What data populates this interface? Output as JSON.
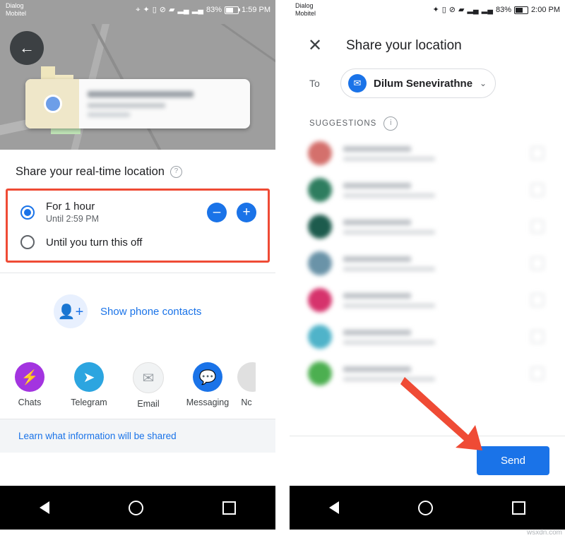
{
  "left": {
    "status": {
      "carrier_line1": "Dialog",
      "carrier_line2": "Mobitel",
      "icons": [
        "location-icon",
        "bluetooth-icon",
        "vibrate-icon",
        "alarm-off-icon",
        "wifi-icon",
        "signal-icon",
        "signal-icon"
      ],
      "battery_percent": "83%",
      "time": "1:59 PM"
    },
    "map": {
      "back_icon": "back-arrow-icon",
      "card_title_blurred": "",
      "card_sub_blurred": ""
    },
    "sheet": {
      "title": "Share your real-time location",
      "help_icon": "help-icon",
      "option1": {
        "label": "For 1 hour",
        "sub": "Until 2:59 PM",
        "selected": true,
        "minus": "–",
        "plus": "+"
      },
      "option2": {
        "label": "Until you turn this off",
        "selected": false
      },
      "contacts": {
        "icon": "person-add-icon",
        "label": "Show phone contacts"
      },
      "apps": [
        {
          "name": "Chats",
          "icon": "messenger-icon",
          "color": "#a334e0",
          "glyph": "⚡"
        },
        {
          "name": "Telegram",
          "icon": "telegram-icon",
          "color": "#2ca5e0",
          "glyph": "➤"
        },
        {
          "name": "Email",
          "icon": "email-icon",
          "color": "#f1f3f4",
          "glyph": "✉"
        },
        {
          "name": "Messaging",
          "icon": "messaging-icon",
          "color": "#1a73e8",
          "glyph": "💬"
        },
        {
          "name": "Nc",
          "icon": "more-apps-icon",
          "color": "#e0e0e0",
          "glyph": ""
        }
      ],
      "learn_more": "Learn what information will be shared"
    },
    "nav": {
      "back": "nav-back-icon",
      "home": "nav-home-icon",
      "recents": "nav-recents-icon"
    }
  },
  "right": {
    "status": {
      "carrier_line1": "Dialog",
      "carrier_line2": "Mobitel",
      "icons": [
        "bluetooth-icon",
        "vibrate-icon",
        "alarm-off-icon",
        "wifi-icon",
        "signal-icon",
        "signal-icon"
      ],
      "battery_percent": "83%",
      "time": "2:00 PM"
    },
    "header": {
      "close_icon": "close-icon",
      "title": "Share your location"
    },
    "to_field": {
      "label": "To",
      "avatar_icon": "mail-avatar-icon",
      "recipient": "Dilum Senevirathne",
      "chevron": "⌄"
    },
    "suggestions": {
      "label": "SUGGESTIONS",
      "info_icon": "info-icon",
      "rows": [
        {
          "avatar_color": "#d4706c"
        },
        {
          "avatar_color": "#2e7d5f"
        },
        {
          "avatar_color": "#1d5b4d"
        },
        {
          "avatar_color": "#6a93a8"
        },
        {
          "avatar_color": "#d6336c"
        },
        {
          "avatar_color": "#4fb3c9"
        },
        {
          "avatar_color": "#4caf50"
        }
      ]
    },
    "send_button": "Send",
    "nav": {
      "back": "nav-back-icon",
      "home": "nav-home-icon",
      "recents": "nav-recents-icon"
    }
  },
  "annotations": {
    "red_highlight_box": "duration-options-highlight",
    "red_arrow": "send-button-arrow"
  },
  "watermark": "wsxdn.com"
}
